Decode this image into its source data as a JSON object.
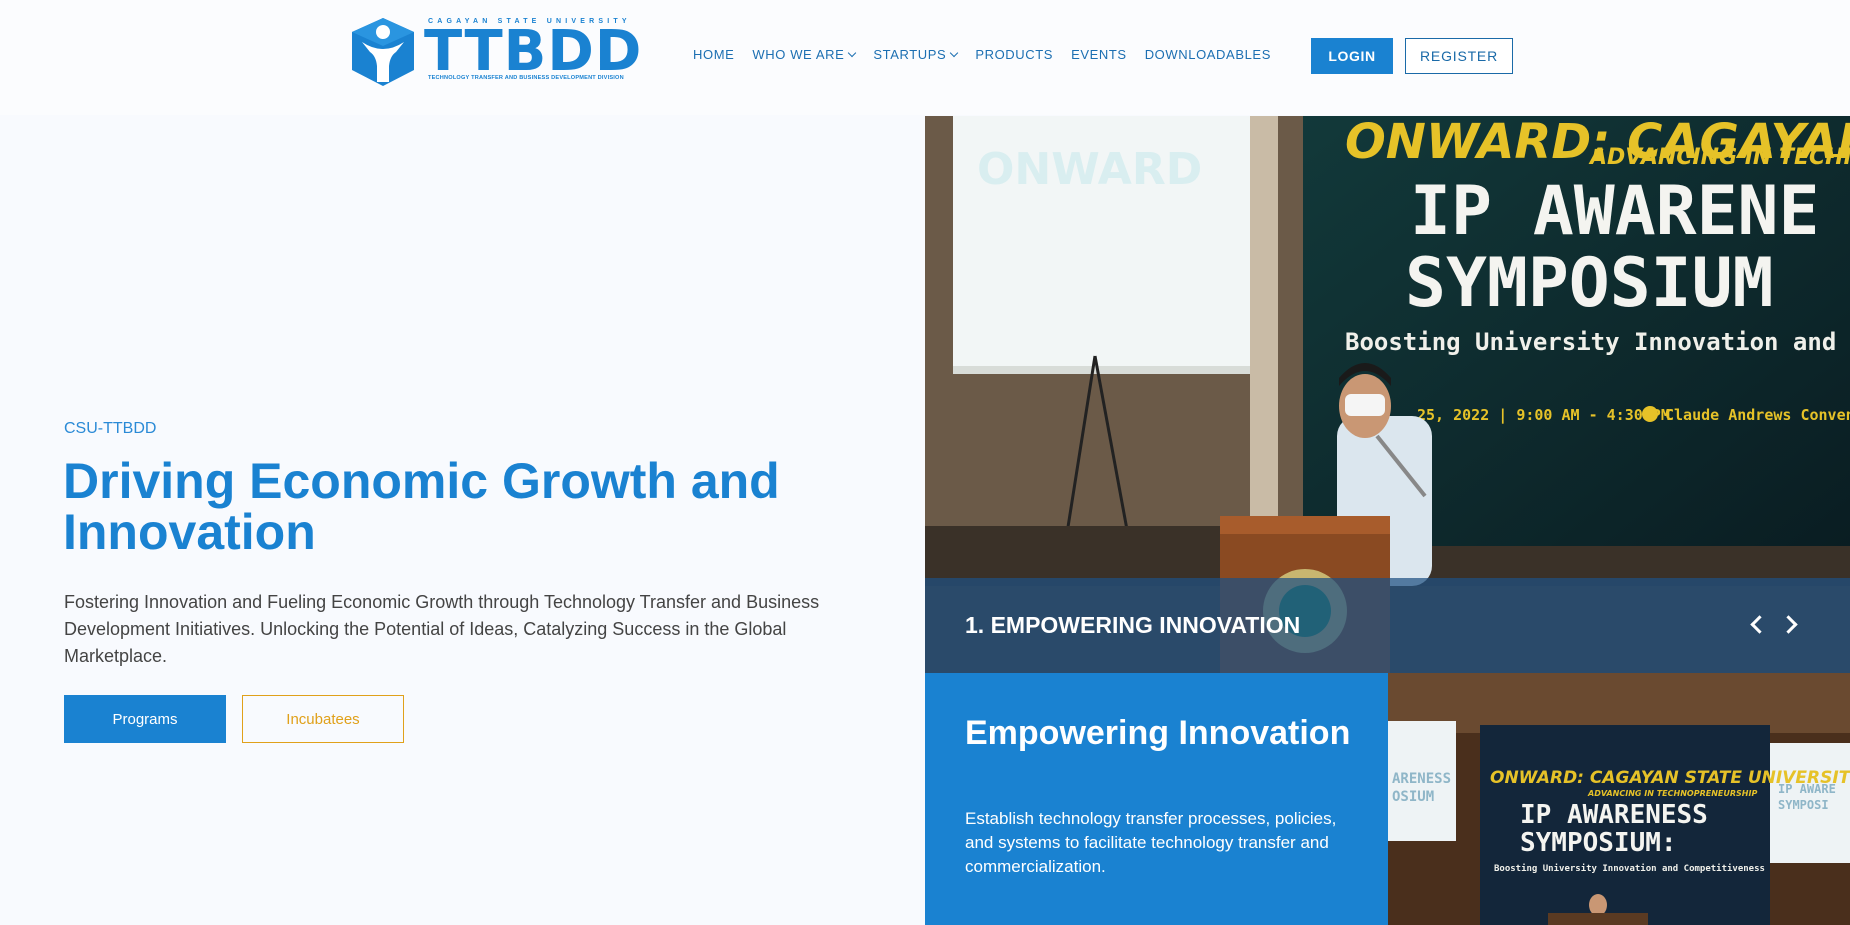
{
  "brand": {
    "university": "CAGAYAN STATE UNIVERSITY",
    "name": "TTBDD",
    "subtitle": "TECHNOLOGY TRANSFER AND BUSINESS DEVELOPMENT DIVISION",
    "color": "#1a82d1"
  },
  "nav": {
    "items": [
      {
        "label": "HOME",
        "dropdown": false
      },
      {
        "label": "WHO WE ARE",
        "dropdown": true
      },
      {
        "label": "STARTUPS",
        "dropdown": true
      },
      {
        "label": "PRODUCTS",
        "dropdown": false
      },
      {
        "label": "EVENTS",
        "dropdown": false
      },
      {
        "label": "DOWNLOADABLES",
        "dropdown": false
      }
    ],
    "login_label": "LOGIN",
    "register_label": "REGISTER"
  },
  "hero": {
    "eyebrow": "CSU-TTBDD",
    "title": "Driving Economic Growth and Innovation",
    "description": "Fostering Innovation and Fueling Economic Growth through Technology Transfer and Business Development Initiatives. Unlocking the Potential of Ideas, Catalyzing Success in the Global Marketplace.",
    "primary_button": "Programs",
    "secondary_button": "Incubatees"
  },
  "slider": {
    "caption": "1. EMPOWERING INNOVATION",
    "banner_line1": "ONWARD: CAGAYAN STATE",
    "banner_line2": "ADVANCING IN TECHN",
    "banner_title1": "IP AWARENE",
    "banner_title2": "SYMPOSIUM",
    "banner_sub": "Boosting University Innovation and Comp",
    "banner_info": "25, 2022 | 9:00 AM - 4:30 PM",
    "banner_venue": "Claude Andrews Conventi",
    "screen_text": "ONWARD"
  },
  "card": {
    "title": "Empowering Innovation",
    "description": "Establish technology transfer processes, policies, and systems to facilitate technology transfer and commercialization."
  },
  "photo2": {
    "banner_line1": "ONWARD: CAGAYAN STATE UNIVERSITY",
    "banner_line2": "ADVANCING IN TECHNOPRENEURSHIP",
    "title1": "IP AWARENESS",
    "title2": "SYMPOSIUM:",
    "sub": "Boosting University Innovation and Competitiveness",
    "left_screen": "ARENESS\nOSIUM",
    "right_screen": "IP AWARE\nSYMPOSI"
  }
}
